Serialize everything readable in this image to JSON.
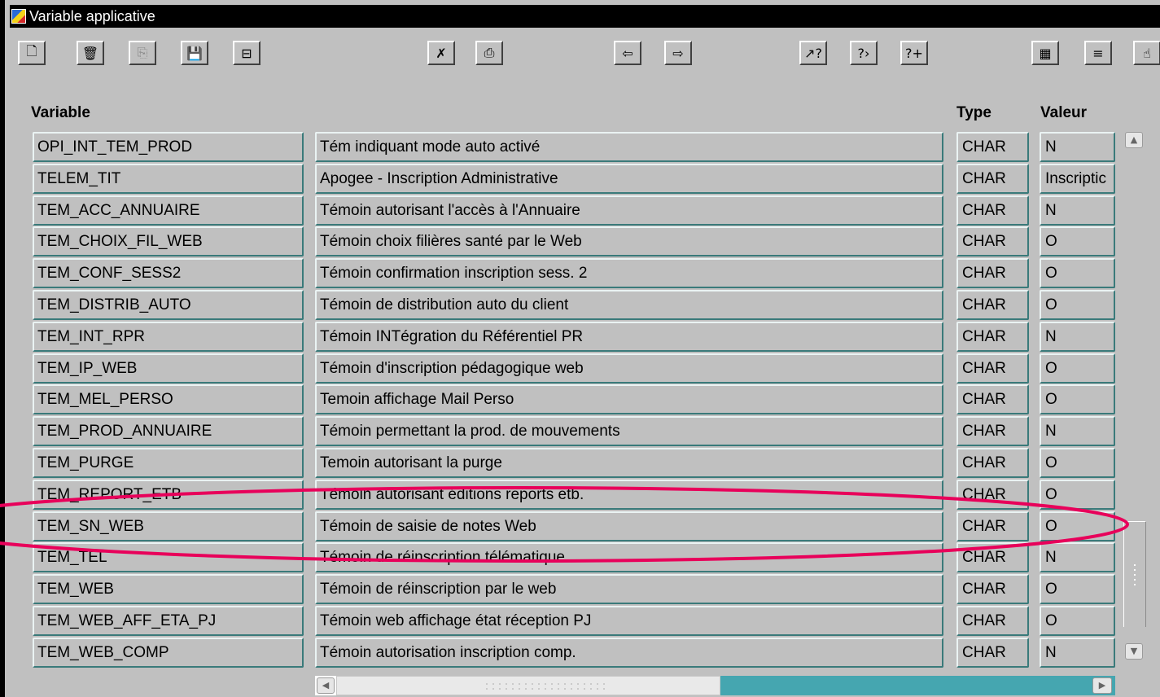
{
  "window": {
    "title": "Variable applicative"
  },
  "toolbar": [
    {
      "name": "new-document-button",
      "icon": "new-document-icon",
      "glyph": "🗋"
    },
    {
      "name": "delete-button",
      "icon": "trash-icon",
      "glyph": "🗑"
    },
    {
      "name": "copy-button",
      "icon": "copy-icon",
      "glyph": "⎘"
    },
    {
      "name": "save-button",
      "icon": "floppy-disk-icon",
      "glyph": "💾"
    },
    {
      "name": "clear-record-button",
      "icon": "clear-record-icon",
      "glyph": "⊟"
    },
    {
      "name": "cancel-query-button",
      "icon": "cancel-query-icon",
      "glyph": "✗"
    },
    {
      "name": "print-button",
      "icon": "printer-icon",
      "glyph": "⎙"
    },
    {
      "name": "previous-record-button",
      "icon": "arrow-left-icon",
      "glyph": "⇦"
    },
    {
      "name": "next-record-button",
      "icon": "arrow-right-icon",
      "glyph": "⇨"
    },
    {
      "name": "enter-query-button",
      "icon": "query-enter-icon",
      "glyph": "↗?"
    },
    {
      "name": "execute-query-button",
      "icon": "query-execute-icon",
      "glyph": "?›"
    },
    {
      "name": "count-query-button",
      "icon": "query-count-icon",
      "glyph": "?+"
    },
    {
      "name": "list-of-values-button",
      "icon": "list-of-values-icon",
      "glyph": "▦"
    },
    {
      "name": "menu-button",
      "icon": "menu-lines-icon",
      "glyph": "≡"
    },
    {
      "name": "help-hand-button",
      "icon": "hand-icon",
      "glyph": "☝"
    }
  ],
  "columns": {
    "variable": "Variable",
    "type": "Type",
    "value": "Valeur"
  },
  "rows": [
    {
      "variable": "OPI_INT_TEM_PROD",
      "description": "Tém indiquant mode auto activé",
      "type": "CHAR",
      "value": "N"
    },
    {
      "variable": "TELEM_TIT",
      "description": "Apogee - Inscription Administrative",
      "type": "CHAR",
      "value": "Inscriptic"
    },
    {
      "variable": "TEM_ACC_ANNUAIRE",
      "description": "Témoin autorisant l'accès à l'Annuaire",
      "type": "CHAR",
      "value": "N"
    },
    {
      "variable": "TEM_CHOIX_FIL_WEB",
      "description": "Témoin choix filières santé par le Web",
      "type": "CHAR",
      "value": "O"
    },
    {
      "variable": "TEM_CONF_SESS2",
      "description": "Témoin confirmation inscription sess. 2",
      "type": "CHAR",
      "value": "O"
    },
    {
      "variable": "TEM_DISTRIB_AUTO",
      "description": "Témoin de distribution auto du client",
      "type": "CHAR",
      "value": "O"
    },
    {
      "variable": "TEM_INT_RPR",
      "description": "Témoin INTégration du Référentiel PR",
      "type": "CHAR",
      "value": "N"
    },
    {
      "variable": "TEM_IP_WEB",
      "description": "Témoin d'inscription pédagogique web",
      "type": "CHAR",
      "value": "O"
    },
    {
      "variable": "TEM_MEL_PERSO",
      "description": "Temoin affichage Mail Perso",
      "type": "CHAR",
      "value": "O"
    },
    {
      "variable": "TEM_PROD_ANNUAIRE",
      "description": "Témoin permettant la prod. de mouvements",
      "type": "CHAR",
      "value": "N"
    },
    {
      "variable": "TEM_PURGE",
      "description": "Temoin autorisant la purge",
      "type": "CHAR",
      "value": "O"
    },
    {
      "variable": "TEM_REPORT_ETB",
      "description": "Témoin autorisant éditions reports etb.",
      "type": "CHAR",
      "value": "O"
    },
    {
      "variable": "TEM_SN_WEB",
      "description": "Témoin de saisie de notes Web",
      "type": "CHAR",
      "value": "O"
    },
    {
      "variable": "TEM_TEL",
      "description": "Témoin de réinscription télématique",
      "type": "CHAR",
      "value": "N"
    },
    {
      "variable": "TEM_WEB",
      "description": "Témoin de réinscription par le web",
      "type": "CHAR",
      "value": "O"
    },
    {
      "variable": "TEM_WEB_AFF_ETA_PJ",
      "description": "Témoin web affichage état réception PJ",
      "type": "CHAR",
      "value": "O"
    },
    {
      "variable": "TEM_WEB_COMP",
      "description": "Témoin autorisation inscription comp.",
      "type": "CHAR",
      "value": "N"
    }
  ],
  "highlight": {
    "row_variable": "TEM_SN_WEB",
    "color": "#e8005a"
  },
  "scrollbars": {
    "vertical_position": 0.95,
    "horizontal_position": 0.0
  }
}
